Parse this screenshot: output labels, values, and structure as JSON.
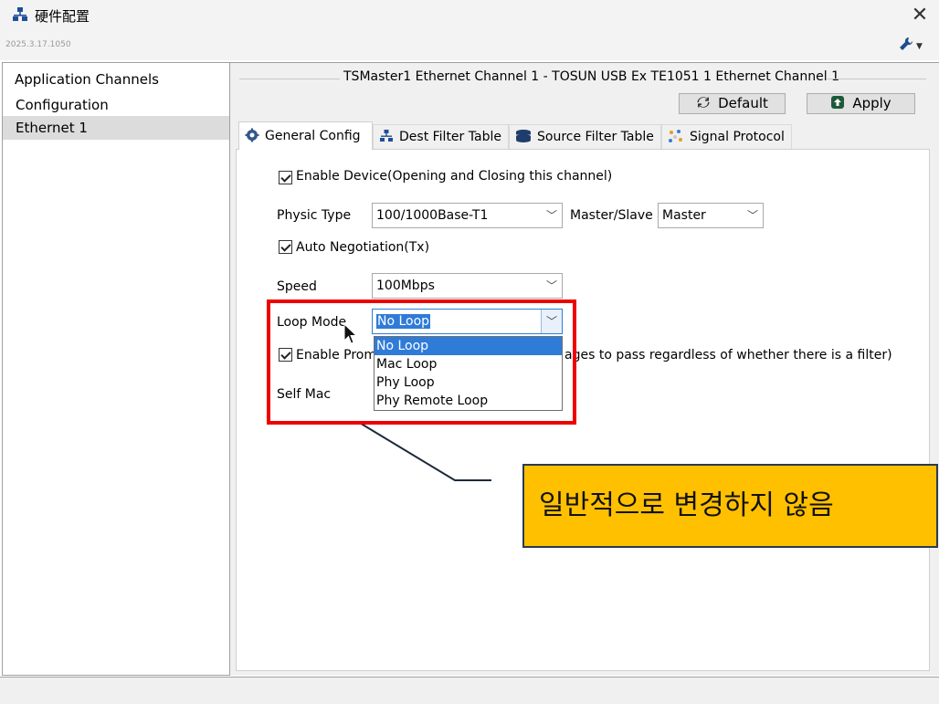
{
  "window": {
    "title": "硬件配置",
    "version": "2025.3.17.1050",
    "close_label": "✕"
  },
  "tree": {
    "items": [
      {
        "label": "Application Channels"
      },
      {
        "label": "Configuration"
      },
      {
        "label": "Ethernet 1",
        "selected": true
      }
    ]
  },
  "panel": {
    "group_title": "TSMaster1 Ethernet Channel 1 - TOSUN USB Ex TE1051 1 Ethernet Channel 1",
    "default_label": "Default",
    "apply_label": "Apply"
  },
  "tabs": [
    {
      "label": "General Config",
      "icon": "gear-icon",
      "active": true
    },
    {
      "label": "Dest Filter Table",
      "icon": "network-icon"
    },
    {
      "label": "Source Filter Table",
      "icon": "stack-icon"
    },
    {
      "label": "Signal Protocol",
      "icon": "signal-icon"
    }
  ],
  "form": {
    "enable_device": {
      "label": "Enable Device(Opening and Closing this channel)",
      "checked": true
    },
    "physic_type": {
      "label": "Physic Type",
      "value": "100/1000Base-T1"
    },
    "master_slave": {
      "label": "Master/Slave",
      "value": "Master"
    },
    "auto_negotiation": {
      "label": "Auto Negotiation(Tx)",
      "checked": true
    },
    "speed": {
      "label": "Speed",
      "value": "100Mbps"
    },
    "loop_mode": {
      "label": "Loop Mode",
      "value": "No Loop",
      "options": [
        "No Loop",
        "Mac Loop",
        "Phy Loop",
        "Phy Remote Loop"
      ]
    },
    "promiscuous": {
      "label_start": "Enable Prom",
      "label_end": "ages to pass regardless of whether there is a filter)",
      "checked": true
    },
    "self_mac": {
      "label": "Self Mac"
    }
  },
  "annotation": {
    "text": "일반적으로 변경하지 않음"
  },
  "colors": {
    "highlight_box": "#ee0000",
    "callout_bg": "#ffc000",
    "selection": "#2f7bd8"
  }
}
